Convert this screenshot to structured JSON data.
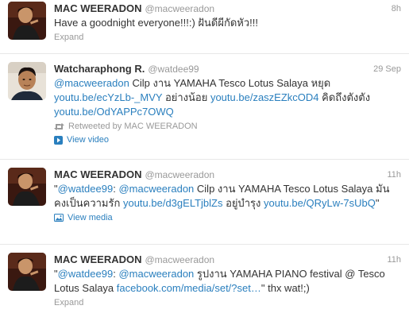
{
  "tweets": [
    {
      "fullname": "MAC WEERADON",
      "username": "@macweeradon",
      "time": "8h",
      "text": "Have a goodnight everyone!!!:) ฝันดีผีกัดหัว!!!",
      "expand": "Expand",
      "avatar_icon": "avatar-portrait"
    },
    {
      "fullname": "Watcharaphong R.",
      "username": "@watdee99",
      "time": "29 Sep",
      "mention": "@macweeradon",
      "text1": " Cilp งาน YAMAHA Tesco Lotus Salaya หยุด ",
      "link1": "youtu.be/ecYzLb-_MVY",
      "text2": " อย่างน้อย ",
      "link2": "youtu.be/zaszEZkcOD4",
      "text3": " คิดถึงตังตัง ",
      "link3": "youtu.be/OdYAPPc7OWQ",
      "retweeted": "Retweeted by MAC WEERADON",
      "action": "View video",
      "avatar_icon": "avatar-portrait"
    },
    {
      "fullname": "MAC WEERADON",
      "username": "@macweeradon",
      "time": "11h",
      "q_open": "\"",
      "mention1": "@watdee99",
      "colon": ": ",
      "mention2": "@macweeradon",
      "text1": " Cilp งาน YAMAHA Tesco Lotus Salaya มันคงเป็นความรัก ",
      "link1": "youtu.be/d3gELTjblZs",
      "text2": " อยู่บำรุง ",
      "link2": "youtu.be/QRyLw-7sUbQ",
      "q_close": "\"",
      "action": "View media",
      "avatar_icon": "avatar-portrait"
    },
    {
      "fullname": "MAC WEERADON",
      "username": "@macweeradon",
      "time": "11h",
      "q_open": "\"",
      "mention1": "@watdee99",
      "colon": ": ",
      "mention2": "@macweeradon",
      "text1": " รูปงาน YAMAHA PIANO festival @ Tesco Lotus Salaya ",
      "link1": "facebook.com/media/set/?set…",
      "text2": "\" thx wat!;)",
      "expand": "Expand",
      "avatar_icon": "avatar-portrait"
    }
  ],
  "colors": {
    "link": "#2a7fbe",
    "meta": "#999999",
    "text": "#333333"
  }
}
